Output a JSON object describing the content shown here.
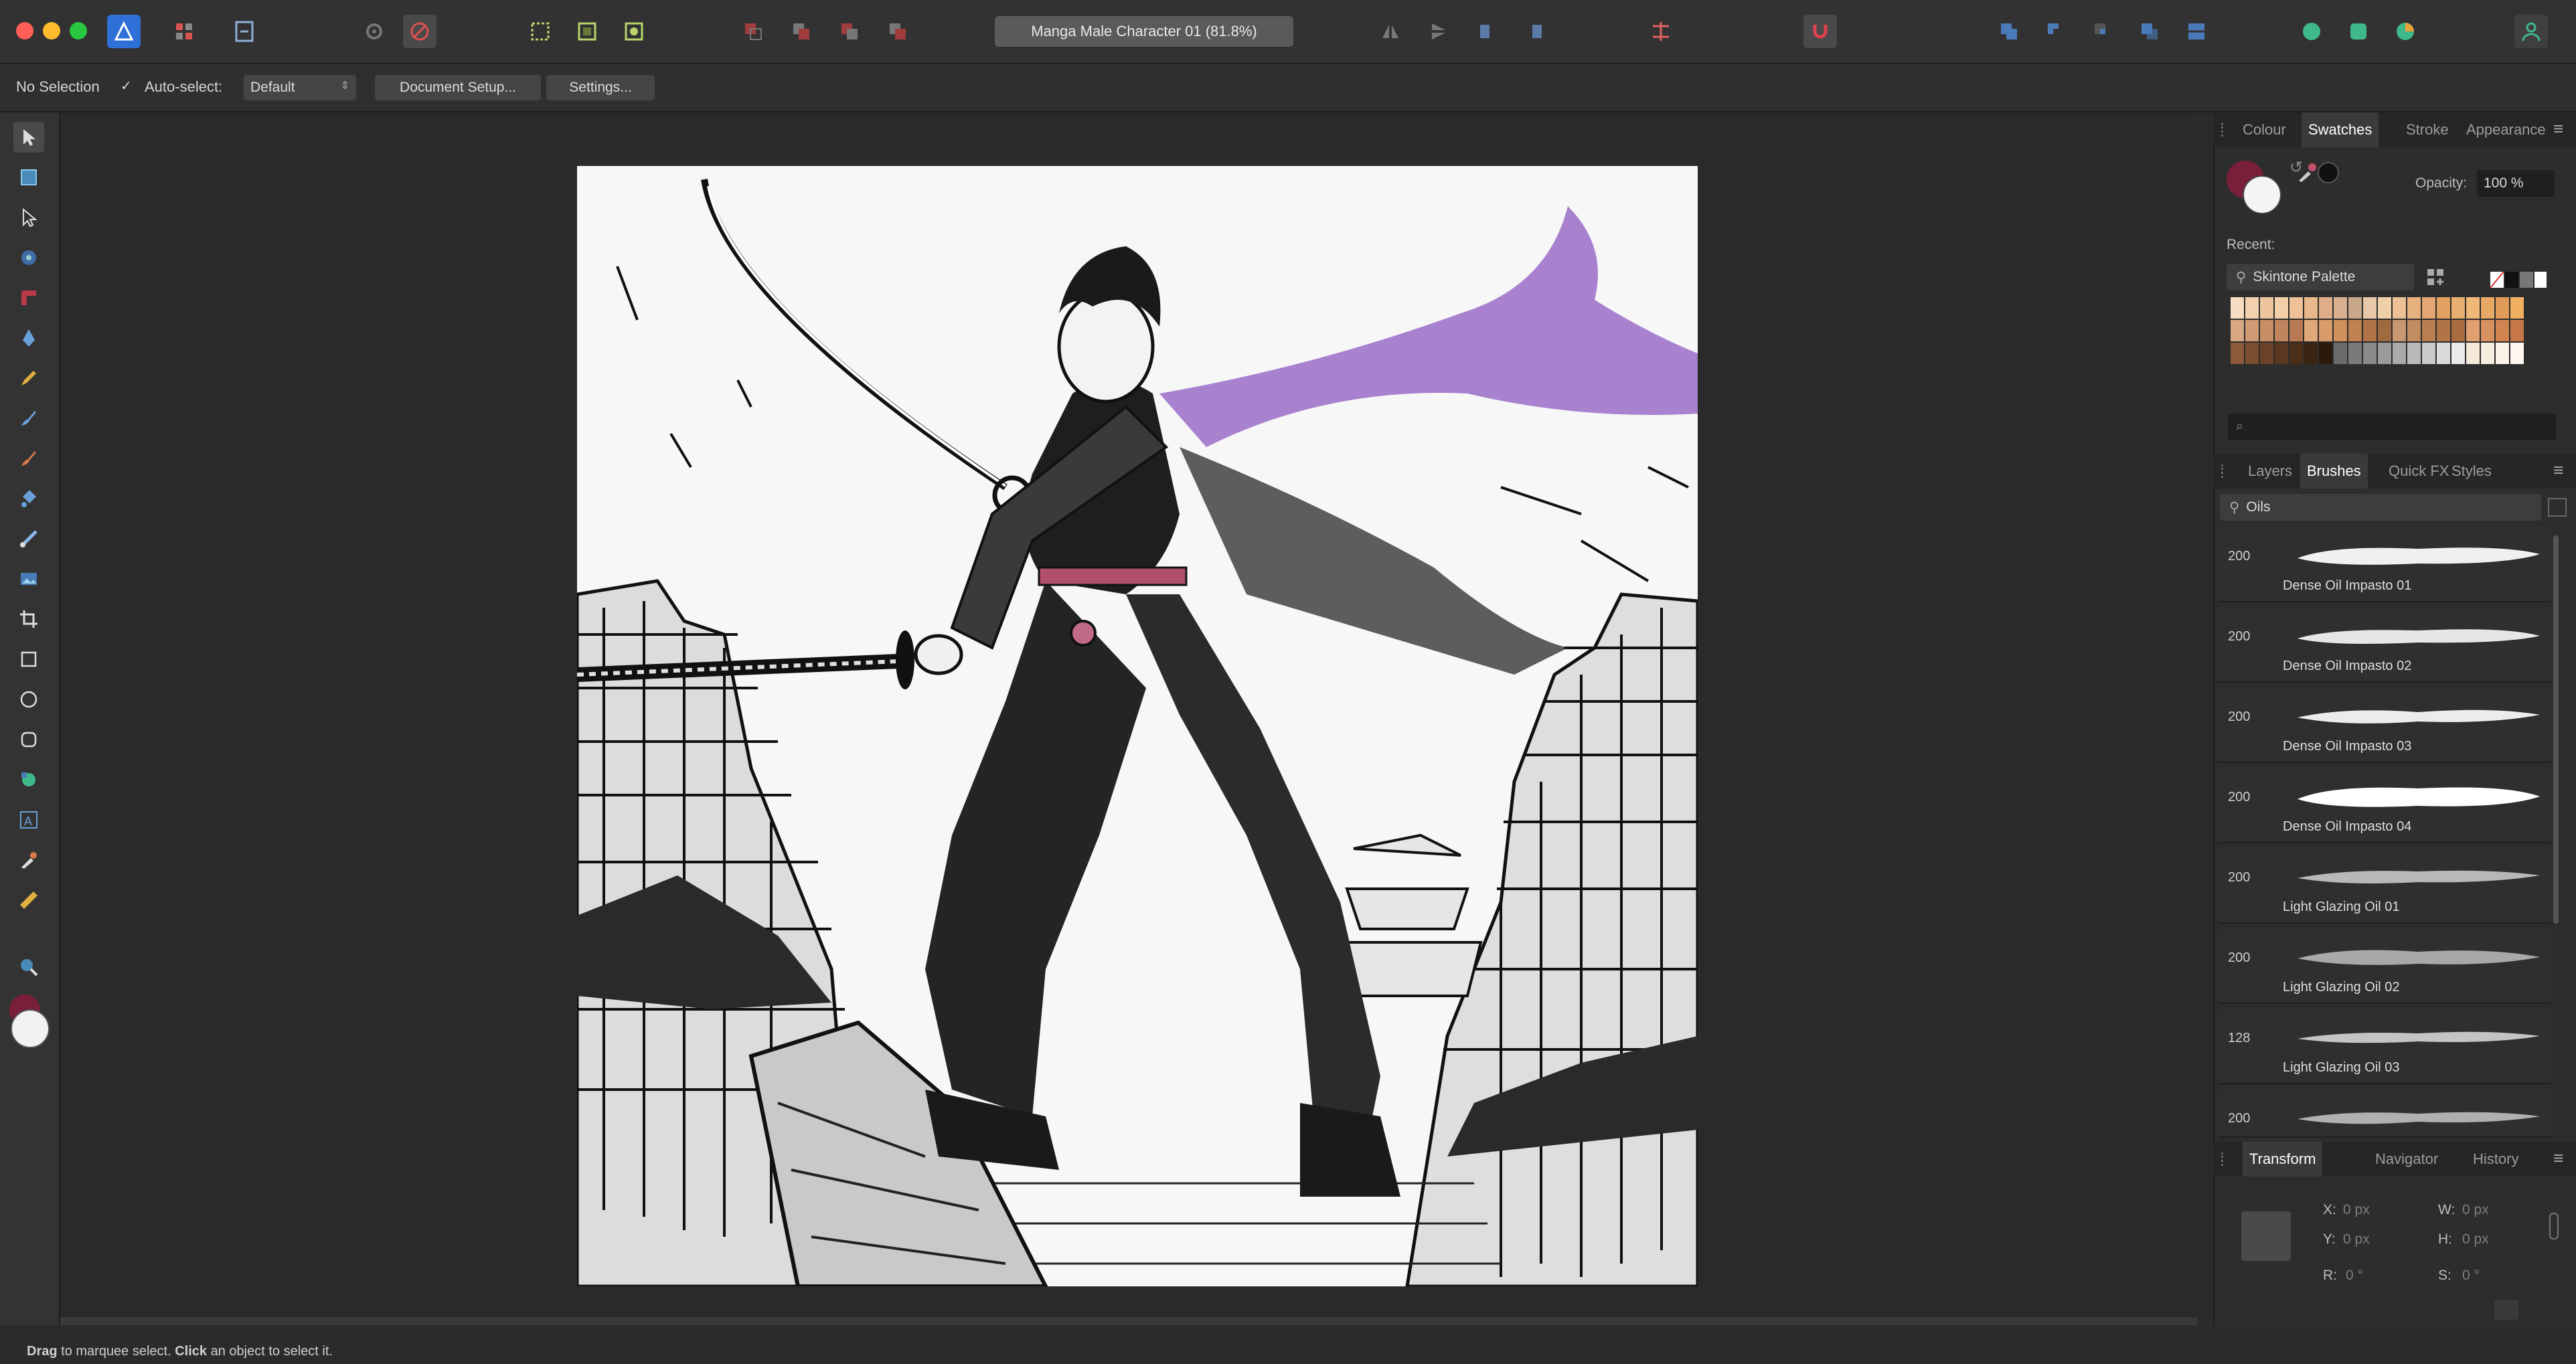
{
  "window": {
    "title": "Manga  Male Character 01 (81.8%)"
  },
  "context_bar": {
    "selection": "No Selection",
    "auto_select_label": "Auto-select:",
    "auto_select_value": "Default",
    "document_setup": "Document Setup...",
    "settings": "Settings..."
  },
  "color_panel": {
    "tabs": [
      "Colour",
      "Swatches",
      "Stroke",
      "Appearance"
    ],
    "active_tab": "Swatches",
    "opacity_label": "Opacity:",
    "opacity_value": "100 %",
    "recent_label": "Recent:",
    "palette": "Skintone Palette",
    "search_placeholder": ""
  },
  "brushes_panel": {
    "tabs": [
      "Layers",
      "Brushes",
      "Quick FX",
      "Styles"
    ],
    "active_tab": "Brushes",
    "category": "Oils",
    "brushes": [
      {
        "size": "200",
        "name": "Dense Oil Impasto 01"
      },
      {
        "size": "200",
        "name": "Dense Oil Impasto 02"
      },
      {
        "size": "200",
        "name": "Dense Oil Impasto 03"
      },
      {
        "size": "200",
        "name": "Dense Oil Impasto 04"
      },
      {
        "size": "200",
        "name": "Light Glazing Oil 01"
      },
      {
        "size": "200",
        "name": "Light Glazing Oil 02"
      },
      {
        "size": "128",
        "name": "Light Glazing Oil 03"
      },
      {
        "size": "200",
        "name": ""
      }
    ]
  },
  "transform_panel": {
    "tabs": [
      "Transform",
      "Navigator",
      "History"
    ],
    "active_tab": "Transform",
    "x_label": "X:",
    "x_value": "0 px",
    "y_label": "Y:",
    "y_value": "0 px",
    "w_label": "W:",
    "w_value": "0 px",
    "h_label": "H:",
    "h_value": "0 px",
    "r_label": "R:",
    "r_value": "0 °",
    "s_label": "S:",
    "s_value": "0 °"
  },
  "status": {
    "bold1": "Drag",
    "text1": " to marquee select. ",
    "bold2": "Click",
    "text2": " an object to select it."
  },
  "colors": {
    "accent": "#4a9eff",
    "stroke_swatch": "#7a1f3a",
    "purple_cape": "#9a6cc8"
  }
}
